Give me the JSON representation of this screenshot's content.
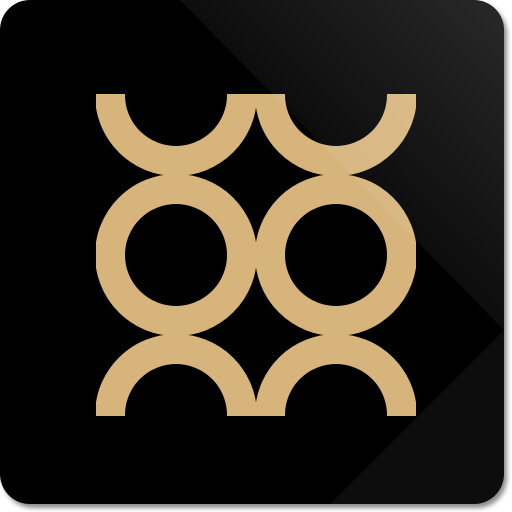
{
  "app_icon": {
    "icon_name": "gold-interlocking-rings-icon",
    "background_color": "#000000",
    "ring_color": "#d6b47c"
  }
}
